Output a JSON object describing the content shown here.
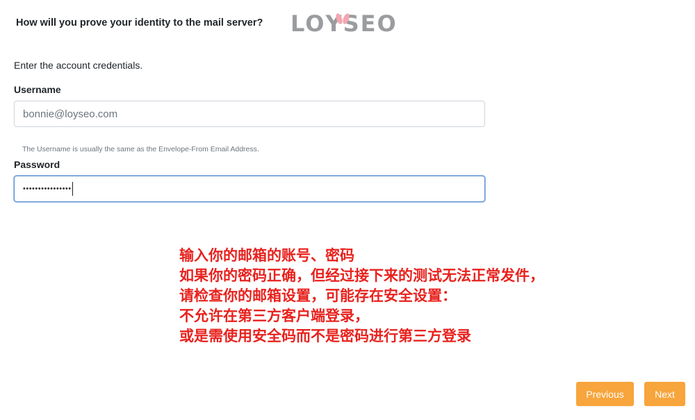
{
  "header": {
    "title": "How will you prove your identity to the mail server?",
    "logo_text_left": "LO",
    "logo_text_mid": "Y",
    "logo_text_right": "SEO"
  },
  "form": {
    "instructions": "Enter the account credentials.",
    "username_label": "Username",
    "username_value": "bonnie@loyseo.com",
    "username_help": "The Username is usually the same as the Envelope-From Email Address.",
    "password_label": "Password",
    "password_masked": "••••••••••••••••"
  },
  "annotation": {
    "lines": [
      "输入你的邮箱的账号、密码",
      "如果你的密码正确，但经过接下来的测试无法正常发件，",
      "请检查你的邮箱设置，可能存在安全设置：",
      "不允许在第三方客户端登录，",
      "或是需使用安全码而不是密码进行第三方登录"
    ],
    "color": "#e8221e"
  },
  "buttons": {
    "previous_label": "Previous",
    "next_label": "Next",
    "color": "#f7a53c"
  }
}
